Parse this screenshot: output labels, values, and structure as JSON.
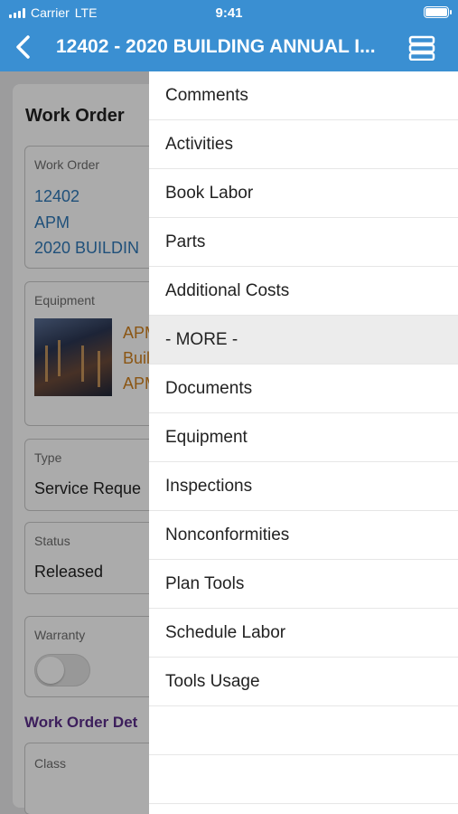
{
  "status_bar": {
    "carrier": "Carrier",
    "network": "LTE",
    "time": "9:41"
  },
  "header": {
    "title": "12402 - 2020 BUILDING ANNUAL I..."
  },
  "icons": {
    "back": "chevron-left-icon",
    "menu": "stack-menu-icon",
    "signal": "signal-bars-icon",
    "battery": "battery-icon"
  },
  "colors": {
    "header_bg": "#3a8fd2",
    "link": "#2f78b7",
    "equipment_text": "#d0801e",
    "section_title": "#5b2f8a"
  },
  "form": {
    "card_title": "Work Order",
    "work_order": {
      "label": "Work Order",
      "number": "12402",
      "org": "APM",
      "description": "2020 BUILDIN"
    },
    "equipment": {
      "label": "Equipment",
      "line1": "APM",
      "line2": "Buil",
      "line3": "APM"
    },
    "type": {
      "label": "Type",
      "value": "Service Reque"
    },
    "status": {
      "label": "Status",
      "value": "Released"
    },
    "warranty": {
      "label": "Warranty",
      "value": false
    },
    "details_section": "Work Order Det",
    "class": {
      "label": "Class"
    }
  },
  "menu": {
    "items": [
      "Comments",
      "Activities",
      "Book Labor",
      "Parts",
      "Additional Costs",
      "- MORE -",
      "Documents",
      "Equipment",
      "Inspections",
      "Nonconformities",
      "Plan Tools",
      "Schedule Labor",
      "Tools Usage"
    ]
  }
}
